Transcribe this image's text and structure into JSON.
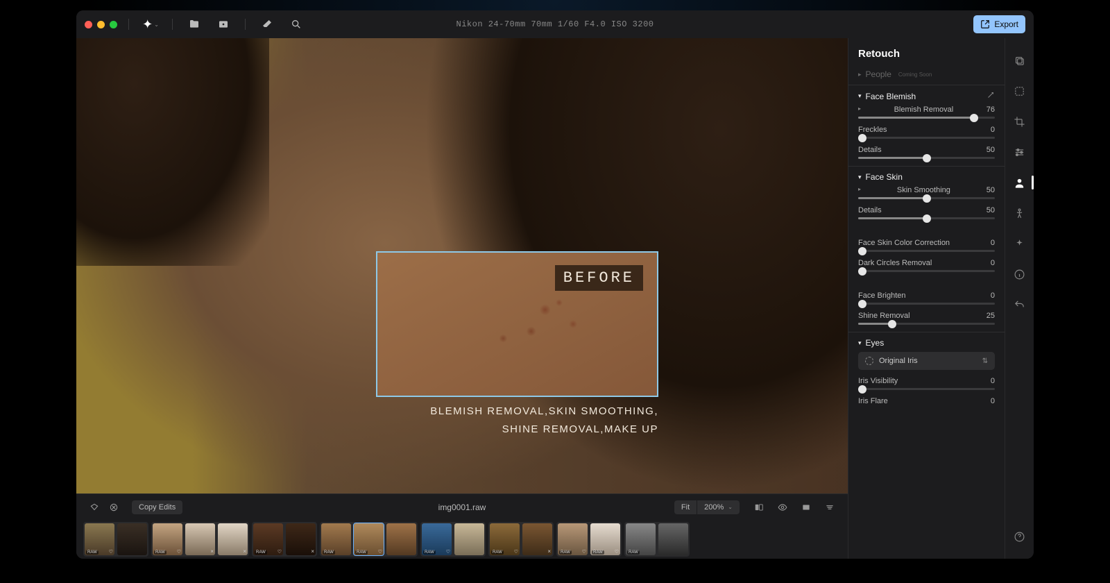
{
  "titlebar": {
    "metadata": "Nikon 24-70mm  70mm  1/60  F4.0  ISO 3200",
    "export_label": "Export"
  },
  "canvas": {
    "before_label": "BEFORE",
    "caption_line1": "BLEMISH REMOVAL,SKIN SMOOTHING,",
    "caption_line2": "SHINE REMOVAL,MAKE UP"
  },
  "infobar": {
    "copy_edits": "Copy Edits",
    "filename": "img0001.raw",
    "fit_label": "Fit",
    "zoom_label": "200%"
  },
  "panel": {
    "title": "Retouch",
    "people_label": "People",
    "people_badge": "Coming Soon",
    "sections": {
      "face_blemish": "Face Blemish",
      "face_skin": "Face Skin",
      "eyes": "Eyes"
    },
    "params": {
      "blemish_removal": {
        "label": "Blemish Removal",
        "value": 76
      },
      "freckles": {
        "label": "Freckles",
        "value": 0
      },
      "details1": {
        "label": "Details",
        "value": 50
      },
      "skin_smoothing": {
        "label": "Skin Smoothing",
        "value": 50
      },
      "details2": {
        "label": "Details",
        "value": 50
      },
      "color_correction": {
        "label": "Face Skin Color Correction",
        "value": 0
      },
      "dark_circles": {
        "label": "Dark Circles Removal",
        "value": 0
      },
      "face_brighten": {
        "label": "Face Brighten",
        "value": 0
      },
      "shine_removal": {
        "label": "Shine Removal",
        "value": 25
      },
      "iris_visibility": {
        "label": "Iris Visibility",
        "value": 0
      },
      "iris_flare": {
        "label": "Iris Flare",
        "value": 0
      }
    },
    "iris_select": "Original Iris"
  },
  "filmstrip": {
    "raw_badge": "RAW"
  }
}
